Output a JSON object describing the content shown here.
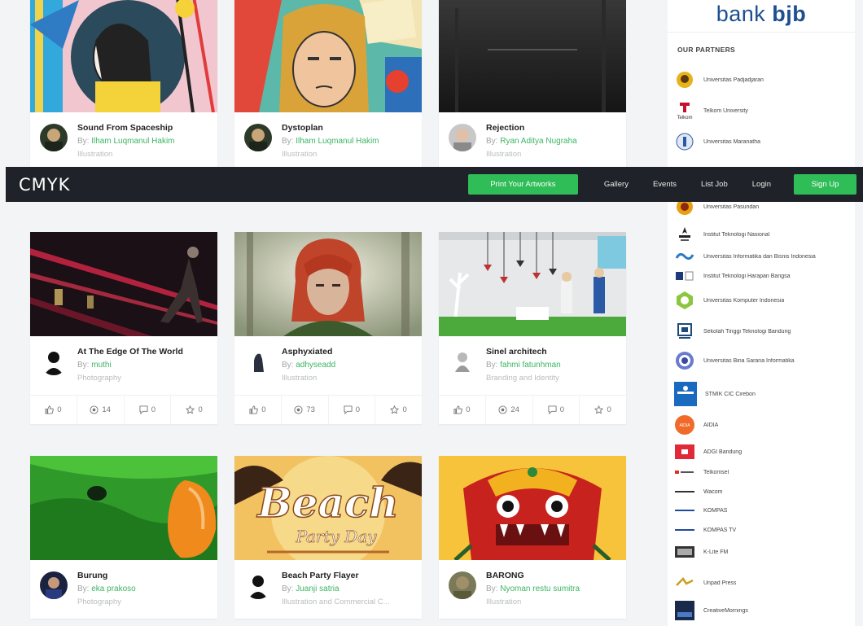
{
  "navbar": {
    "brand": "CMYK",
    "print_label": "Print Your Artworks",
    "links": [
      "Gallery",
      "Events",
      "List Job",
      "Login"
    ],
    "signup_label": "Sign Up"
  },
  "by_prefix": "By: ",
  "cards": [
    {
      "title": "Sound From Spaceship",
      "author": "Ilham Luqmanul Hakim",
      "category": "Illustration",
      "stats": []
    },
    {
      "title": "Dystoplan",
      "author": "Ilham Luqmanul Hakim",
      "category": "Illustration",
      "stats": []
    },
    {
      "title": "Rejection",
      "author": "Ryan Aditya Nugraha",
      "category": "Illustration",
      "stats": []
    },
    {
      "title": "At The Edge Of The World",
      "author": "muthi",
      "category": "Photography",
      "stats": [
        "0",
        "14",
        "0",
        "0"
      ]
    },
    {
      "title": "Asphyxiated",
      "author": "adhyseadd",
      "category": "Illustration",
      "stats": [
        "0",
        "73",
        "0",
        "0"
      ]
    },
    {
      "title": "Sinel architech",
      "author": "fahmi fatunhman",
      "category": "Branding and Identity",
      "stats": [
        "0",
        "24",
        "0",
        "0"
      ]
    },
    {
      "title": "Burung",
      "author": "eka prakoso",
      "category": "Photography",
      "stats": []
    },
    {
      "title": "Beach Party Flayer",
      "author": "Juanji satria",
      "category": "Illustration and Commercial C...",
      "stats": []
    },
    {
      "title": "BARONG",
      "author": "Nyoman restu sumitra",
      "category": "Illustration",
      "stats": []
    }
  ],
  "thumb_text": {
    "beach_word": "Beach",
    "beach_sub": "Party Day"
  },
  "sidebar": {
    "sponsor_text": "bank ",
    "sponsor_bold": "bjb",
    "partners_title": "OUR PARTNERS",
    "partners": [
      {
        "name": "Universitas Padjadjaran",
        "logo_text": ""
      },
      {
        "name": "Telkom University",
        "logo_text": "Telkom"
      },
      {
        "name": "Universitas Maranatha",
        "logo_text": ""
      },
      {
        "name": "Universitas Pasundan",
        "logo_text": ""
      },
      {
        "name": "Institut Teknologi Nasional",
        "logo_text": ""
      },
      {
        "name": "Universitas Informatika dan Bisnis Indonesia",
        "logo_text": ""
      },
      {
        "name": "Institut Teknologi Harapan Bangsa",
        "logo_text": ""
      },
      {
        "name": "Universitas Komputer Indonesia",
        "logo_text": ""
      },
      {
        "name": "Sekolah Tinggi Teknologi Bandung",
        "logo_text": ""
      },
      {
        "name": "Universitas Bina Sarana Informatika",
        "logo_text": ""
      },
      {
        "name": "STMIK CIC Cirebon",
        "logo_text": ""
      },
      {
        "name": "AIDIA",
        "logo_text": "AIDIA"
      },
      {
        "name": "ADGI Bandung",
        "logo_text": ""
      },
      {
        "name": "Telkomsel",
        "logo_text": ""
      },
      {
        "name": "Wacom",
        "logo_text": ""
      },
      {
        "name": "KOMPAS",
        "logo_text": ""
      },
      {
        "name": "KOMPAS TV",
        "logo_text": ""
      },
      {
        "name": "K-Lite FM",
        "logo_text": ""
      },
      {
        "name": "Unpad Press",
        "logo_text": ""
      },
      {
        "name": "CreativeMornings",
        "logo_text": ""
      }
    ]
  }
}
